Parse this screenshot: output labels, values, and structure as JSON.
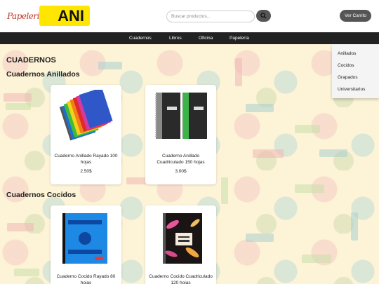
{
  "header": {
    "logo_script": "Papeleria",
    "logo_text": "ANI",
    "search_placeholder": "Buscar productos...",
    "search_icon": "search-icon",
    "cart_label": "Ver Carrito"
  },
  "nav": {
    "items": [
      "Cuadernos",
      "Libros",
      "Oficina",
      "Papelería"
    ]
  },
  "dropdown": {
    "items": [
      "Anillados",
      "Cocidos",
      "Grapados",
      "Universitarios"
    ]
  },
  "page": {
    "category_title": "CUADERNOS",
    "sections": [
      {
        "title": "Cuadernos Anillados",
        "products": [
          {
            "name": "Cuaderno Anillado Rayado 100 hojas",
            "price": "2.50$"
          },
          {
            "name": "Cuaderno Anillado Cuadriculado 150 hojas",
            "price": "3.00$"
          }
        ]
      },
      {
        "title": "Cuadernos Cocidos",
        "products": [
          {
            "name": "Cuaderno Cocido Rayado 80 hojas",
            "price": ""
          },
          {
            "name": "Cuaderno Cocido Cuadriculado 120 hojas",
            "price": ""
          }
        ]
      }
    ]
  },
  "colors": {
    "nav_bg": "#222222",
    "logo_yellow": "#ffe600",
    "button_bg": "#555555",
    "page_bg": "#fdf3d6"
  }
}
